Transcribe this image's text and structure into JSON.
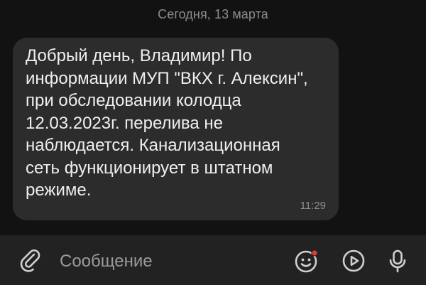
{
  "conversation": {
    "date_separator": "Сегодня, 13 марта",
    "messages": [
      {
        "text": "Добрый день, Владимир! По\nинформации МУП \"ВКХ г. Алексин\",\nпри обследовании колодца\n12.03.2023г. перелива не\nнаблюдается. Канализационная\nсеть функционирует в штатном\nрежиме.",
        "time": "11:29"
      }
    ]
  },
  "composer": {
    "placeholder": "Сообщение",
    "icons": {
      "attach": "paperclip-icon",
      "emoji": "smiley-icon",
      "video": "play-circle-icon",
      "voice": "microphone-icon"
    },
    "notification_dot_color": "#e53935"
  },
  "colors": {
    "background": "#121212",
    "bubble": "#2c2c2c",
    "composer": "#222222",
    "text": "#efefef",
    "muted": "#8d8d8d"
  }
}
